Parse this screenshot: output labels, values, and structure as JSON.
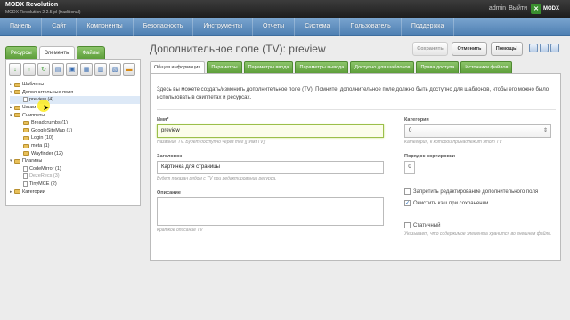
{
  "app": {
    "title": "MODX Revolution",
    "version": "MODX Revolution 2.2.5-pl (traditional)",
    "user": "admin",
    "logout": "Выйти",
    "logo_text": "MODX"
  },
  "menu": [
    "Панель",
    "Сайт",
    "Компоненты",
    "Безопасность",
    "Инструменты",
    "Отчеты",
    "Система",
    "Пользователь",
    "Поддержка"
  ],
  "left_tabs": [
    "Ресурсы",
    "Элементы",
    "Файлы"
  ],
  "tree": [
    {
      "label": "Шаблоны",
      "level": 1,
      "type": "folder",
      "exp": "▸"
    },
    {
      "label": "Дополнительные поля",
      "level": 1,
      "type": "folder",
      "exp": "▾"
    },
    {
      "label": "preview (4)",
      "level": 2,
      "type": "doc",
      "exp": ""
    },
    {
      "label": "Чанки",
      "level": 1,
      "type": "folder",
      "exp": "▸"
    },
    {
      "label": "Сниппеты",
      "level": 1,
      "type": "folder",
      "exp": "▾"
    },
    {
      "label": "Breadcrumbs (1)",
      "level": 2,
      "type": "folder",
      "exp": ""
    },
    {
      "label": "GoogleSiteMap (1)",
      "level": 2,
      "type": "folder",
      "exp": ""
    },
    {
      "label": "Login (10)",
      "level": 2,
      "type": "folder",
      "exp": ""
    },
    {
      "label": "meta (1)",
      "level": 2,
      "type": "folder",
      "exp": ""
    },
    {
      "label": "Wayfinder (12)",
      "level": 2,
      "type": "folder",
      "exp": ""
    },
    {
      "label": "Плагины",
      "level": 1,
      "type": "folder",
      "exp": "▾"
    },
    {
      "label": "CodeMirror (1)",
      "level": 2,
      "type": "doc",
      "exp": ""
    },
    {
      "label": "DezeRecs (3)",
      "level": 2,
      "type": "doc",
      "exp": "",
      "muted": true
    },
    {
      "label": "TinyMCE (2)",
      "level": 2,
      "type": "doc",
      "exp": ""
    },
    {
      "label": "Категории",
      "level": 1,
      "type": "folder",
      "exp": "▸"
    }
  ],
  "page": {
    "title": "Дополнительное поле (TV): preview",
    "save": "Сохранить",
    "cancel": "Отменить",
    "help": "Помощь!"
  },
  "main_tabs": [
    "Общая информация",
    "Параметры",
    "Параметры ввода",
    "Параметры вывода",
    "Доступно для шаблонов",
    "Права доступа",
    "Источники файлов"
  ],
  "form": {
    "description": "Здесь вы можете создать/изменить дополнительное поле (TV). Помните, дополнительное поле должно быть доступно для шаблонов, чтобы его можно было использовать в сниппетах и ресурсах.",
    "name_label": "Имя*",
    "name_value": "preview",
    "name_hint": "Название TV. Будет доступно через тег [[*ИмяTV]]",
    "caption_label": "Заголовок",
    "caption_value": "Картинка для страницы",
    "caption_hint": "Будет показан рядом с TV при редактировании ресурса.",
    "desc_label": "Описание",
    "desc_hint": "Краткое описание TV",
    "category_label": "Категория",
    "category_value": "0",
    "category_hint": "Категория, к которой принадлежит этот TV",
    "rank_label": "Порядок сортировки",
    "rank_value": "0",
    "lock_label": "Запретить редактирование дополнительного поля",
    "lock_checked": false,
    "clear_cache_label": "Очистить кэш при сохранении",
    "clear_cache_checked": true,
    "static_label": "Статичный",
    "static_checked": false,
    "static_hint": "Указывает, что содержимое элемента хранится во внешнем файле."
  }
}
